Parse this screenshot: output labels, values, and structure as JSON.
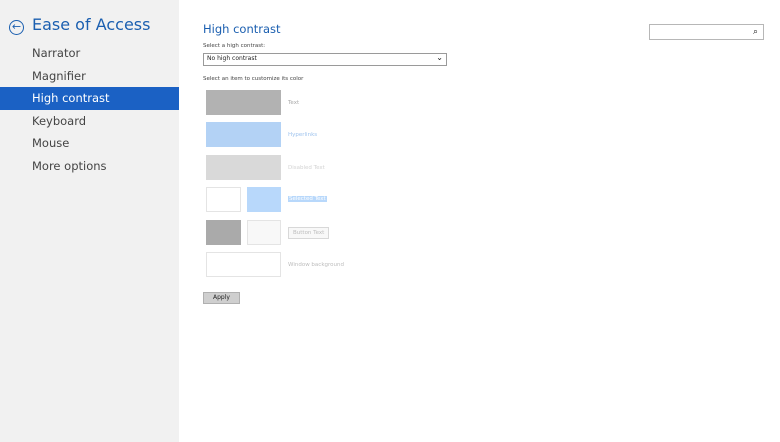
{
  "sidebar": {
    "title": "Ease of Access",
    "back_icon": "←",
    "items": [
      {
        "label": "Narrator"
      },
      {
        "label": "Magnifier"
      },
      {
        "label": "High contrast"
      },
      {
        "label": "Keyboard"
      },
      {
        "label": "Mouse"
      },
      {
        "label": "More options"
      }
    ],
    "selected_index": 2
  },
  "main": {
    "title": "High contrast",
    "search_icon": "⌕",
    "select_label": "Select a high contrast:",
    "select_value": "No high contrast",
    "customize_label": "Select an item to customize its color",
    "items": {
      "text": "Text",
      "hyperlinks": "Hyperlinks",
      "disabled_text": "Disabled Text",
      "selected_text": "Selected Text",
      "button_text": "Button Text",
      "window_background": "Window background"
    },
    "apply_label": "Apply"
  },
  "colors": {
    "accent": "#1b5fb0",
    "selected_nav": "#1b61c4",
    "text_swatch": "#b2b2b2",
    "hyperlink_swatch": "#b3d2f5",
    "disabled_swatch": "#d9d9d9",
    "selected_swatch": "#b8d8fb"
  }
}
